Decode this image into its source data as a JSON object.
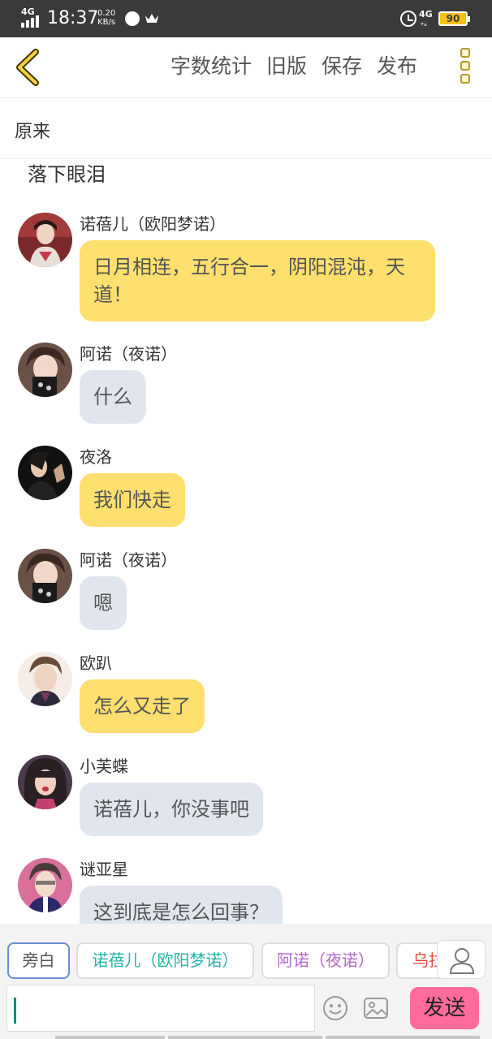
{
  "status_bar": {
    "network": "4G",
    "time": "18:37",
    "speed_value": "0.20",
    "speed_unit": "KB/s",
    "network_right": "4G",
    "battery": "90"
  },
  "toolbar": {
    "word_count_label": "字数统计",
    "old_version_label": "旧版",
    "save_label": "保存",
    "publish_label": "发布"
  },
  "story": {
    "title": "原来",
    "narration": "落下眼泪"
  },
  "messages": [
    {
      "speaker": "诺蓓儿（欧阳梦诺）",
      "text": "日月相连，五行合一，阴阳混沌，天道！",
      "style": "yellow",
      "avatar_color": "#b24a4a"
    },
    {
      "speaker": "阿诺（夜诺）",
      "text": "什么",
      "style": "gray",
      "avatar_color": "#5a4a48"
    },
    {
      "speaker": "夜洛",
      "text": "我们快走",
      "style": "yellow",
      "avatar_color": "#1a1a1a"
    },
    {
      "speaker": "阿诺（夜诺）",
      "text": "嗯",
      "style": "gray",
      "avatar_color": "#5a4a48"
    },
    {
      "speaker": "欧趴",
      "text": "怎么又走了",
      "style": "yellow",
      "avatar_color": "#e9d2c6"
    },
    {
      "speaker": "小芙蝶",
      "text": "诺蓓儿，你没事吧",
      "style": "gray",
      "avatar_color": "#6a4a5a"
    },
    {
      "speaker": "谜亚星",
      "text": "这到底是怎么回事？",
      "style": "gray",
      "avatar_color": "#c7547e"
    }
  ],
  "character_tabs": [
    {
      "label": "旁白",
      "color": "#555555",
      "selected": true
    },
    {
      "label": "诺蓓儿（欧阳梦诺）",
      "color": "#26b3a6"
    },
    {
      "label": "阿诺（夜诺）",
      "color": "#b069c9"
    },
    {
      "label": "乌拉",
      "color": "#e0503a"
    }
  ],
  "input": {
    "value": "",
    "send_label": "发送"
  },
  "colors": {
    "bubble_yellow": "#ffdf6e",
    "bubble_gray": "#e1e6ee",
    "send_button": "#ff6c9c",
    "accent_gold": "#b39a2a"
  }
}
